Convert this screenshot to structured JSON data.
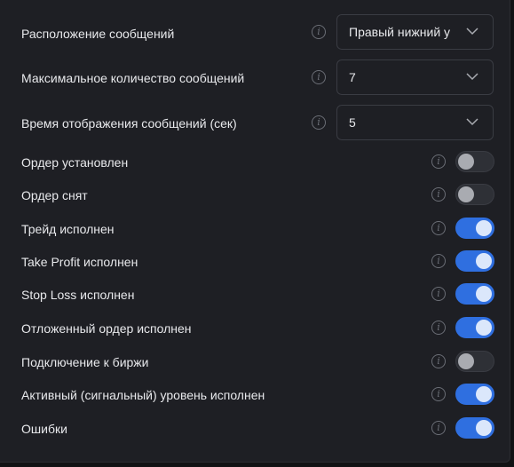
{
  "selects": [
    {
      "label": "Расположение сообщений",
      "value": "Правый нижний у",
      "icon": "chevron-down-icon"
    },
    {
      "label": "Максимальное количество сообщений",
      "value": "7",
      "icon": "chevron-down-icon"
    },
    {
      "label": "Время отображения сообщений (сек)",
      "value": "5",
      "icon": "chevron-down-icon"
    }
  ],
  "toggles": [
    {
      "label": "Ордер установлен",
      "enabled": false
    },
    {
      "label": "Ордер снят",
      "enabled": false
    },
    {
      "label": "Трейд исполнен",
      "enabled": true
    },
    {
      "label": "Take Profit исполнен",
      "enabled": true
    },
    {
      "label": "Stop Loss исполнен",
      "enabled": true
    },
    {
      "label": "Отложенный ордер исполнен",
      "enabled": true
    },
    {
      "label": "Подключение к биржи",
      "enabled": false
    },
    {
      "label": "Активный (сигнальный) уровень исполнен",
      "enabled": true
    },
    {
      "label": "Ошибки",
      "enabled": true
    }
  ],
  "info_icon": {
    "glyph": "i",
    "name": "info-icon"
  },
  "colors": {
    "accent": "#2f6fe0",
    "background": "#1e1f24",
    "text": "#e8e9ec"
  }
}
